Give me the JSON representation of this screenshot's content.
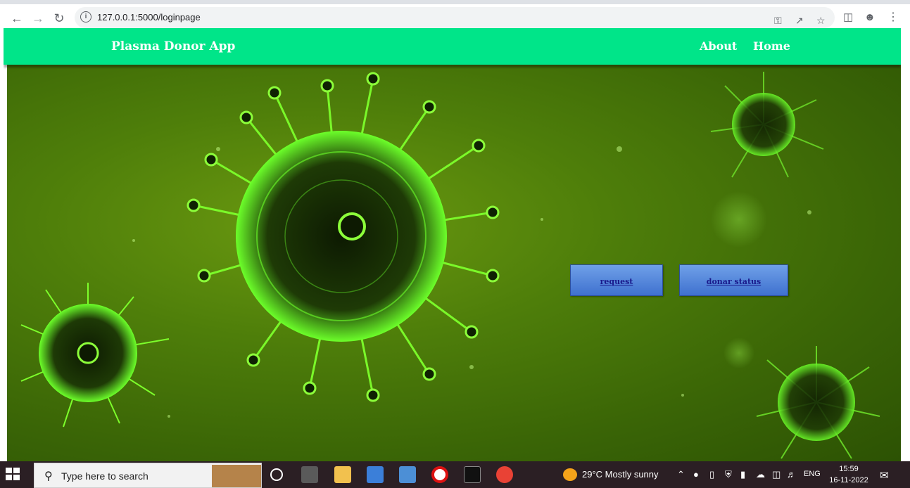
{
  "browser": {
    "url": "127.0.0.1:5000/loginpage"
  },
  "app": {
    "brand": "Plasma Donor App",
    "nav": {
      "about": "About",
      "home": "Home"
    },
    "buttons": {
      "request": "request",
      "donar_status": "donar status"
    },
    "colors": {
      "navbar": "#00e589",
      "button": "#4a7ede",
      "background": "#4e7e0a"
    }
  },
  "taskbar": {
    "search_placeholder": "Type here to search",
    "weather": "29°C  Mostly sunny",
    "language": "ENG",
    "time": "15:59",
    "date": "16-11-2022"
  }
}
